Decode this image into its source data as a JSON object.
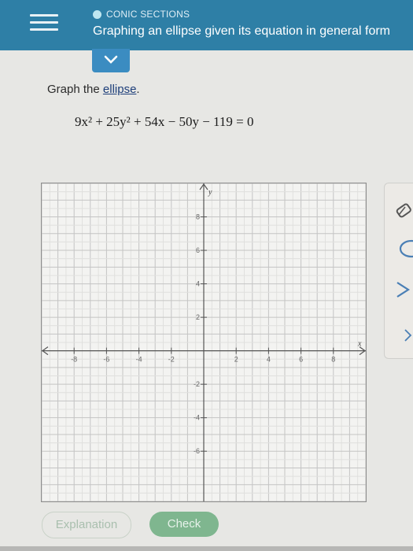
{
  "header": {
    "section": "CONIC SECTIONS",
    "title": "Graphing an ellipse given its equation in general form"
  },
  "problem": {
    "prompt_prefix": "Graph the ",
    "prompt_link": "ellipse",
    "prompt_suffix": ".",
    "equation": "9x² + 25y² + 54x − 50y − 119 = 0"
  },
  "graph": {
    "x_axis_label": "x",
    "y_axis_label": "y",
    "x_tick_labels": [
      "-8",
      "-6",
      "-4",
      "-2",
      "2",
      "4",
      "6",
      "8"
    ],
    "y_tick_labels": [
      "8",
      "6",
      "4",
      "2",
      "-2",
      "-4",
      "-6"
    ],
    "x_range": [
      -10,
      10
    ],
    "y_range": [
      -9,
      10
    ],
    "grid": true
  },
  "tools": [
    "eraser-icon",
    "ellipse-icon",
    "chevron-icon"
  ],
  "buttons": {
    "explanation": "Explanation",
    "check": "Check"
  },
  "colors": {
    "header": "#2e7fa6",
    "check_button": "#7fb68f"
  }
}
